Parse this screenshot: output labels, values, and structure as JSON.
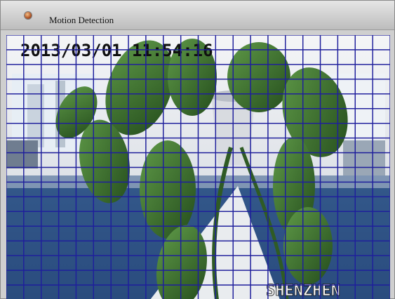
{
  "window": {
    "title": "Motion Detection",
    "title_icon": "app-orb-icon"
  },
  "video": {
    "timestamp": "2013/03/01 11:54:16",
    "watermark": "SHENZHEN"
  },
  "grid": {
    "columns": 22,
    "rows": 18,
    "line_color": "#1f1f9c"
  }
}
